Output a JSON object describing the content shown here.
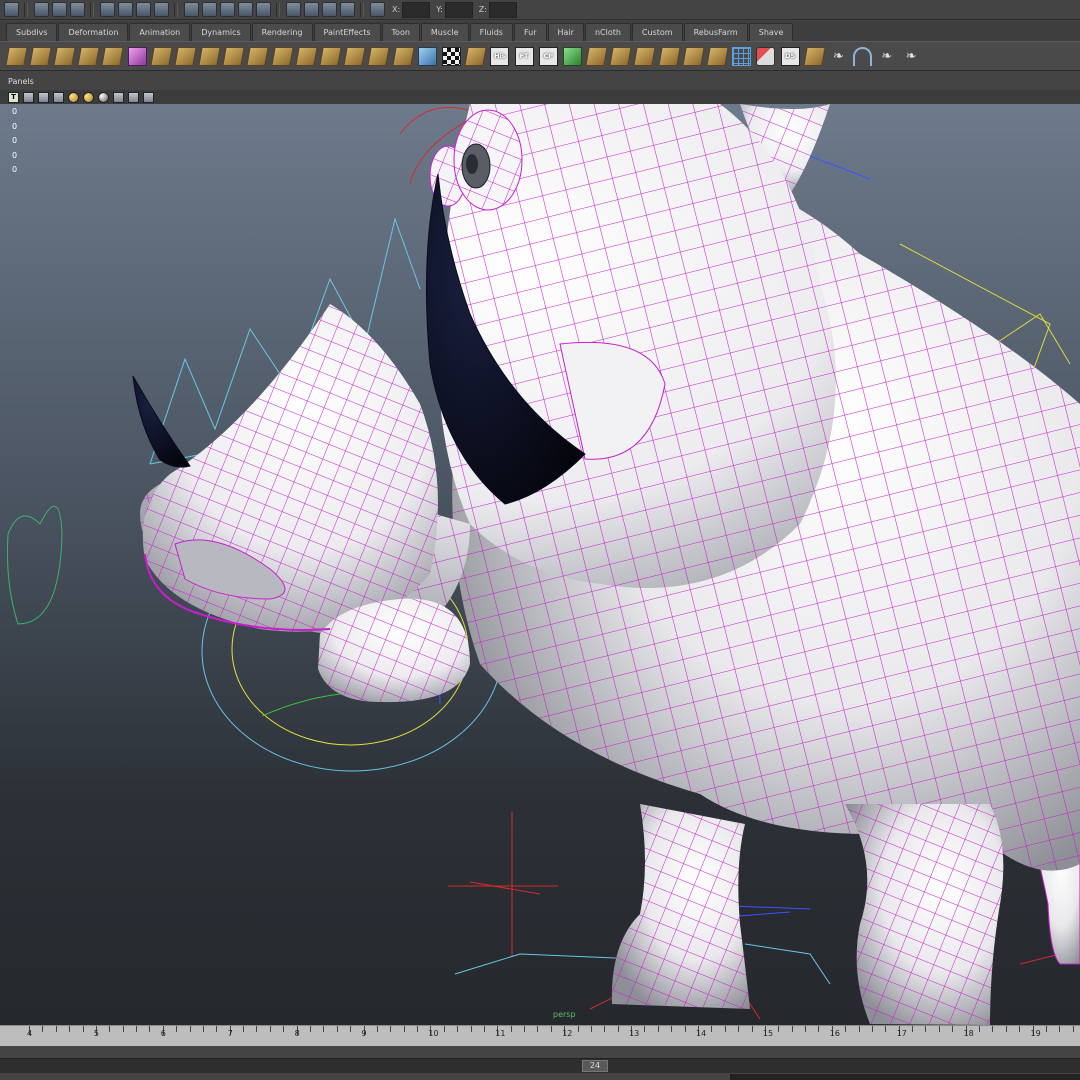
{
  "status_line": {
    "icons": [
      "menu-set-icon",
      "new-scene-icon",
      "open-scene-icon",
      "save-scene-icon",
      "select-hierarchy-icon",
      "select-object-icon",
      "select-component-icon",
      "lock-icon",
      "snap-grid-icon",
      "snap-curve-icon",
      "snap-point-icon",
      "snap-view-plane-icon",
      "make-live-icon",
      "render-frame-icon",
      "ipr-render-icon",
      "render-settings-icon",
      "hypershade-icon",
      "input-line-icon"
    ],
    "xyz_labels": [
      "X:",
      "Y:",
      "Z:"
    ]
  },
  "shelf_tabs": [
    "Subdivs",
    "Deformation",
    "Animation",
    "Dynamics",
    "Rendering",
    "PaintEffects",
    "Toon",
    "Muscle",
    "Fluids",
    "Fur",
    "Hair",
    "nCloth",
    "Custom",
    "RebusFarm",
    "Shave"
  ],
  "shelf_buttons": [
    {
      "icon": "paint-fur-icon",
      "label": ""
    },
    {
      "icon": "fur-description-icon",
      "label": ""
    },
    {
      "icon": "fur-offset-icon",
      "label": ""
    },
    {
      "icon": "fur-tile-1-icon",
      "label": ""
    },
    {
      "icon": "fur-tile-2-icon",
      "label": ""
    },
    {
      "icon": "shave-cube-icon",
      "label": ""
    },
    {
      "icon": "fur-tile-3-icon",
      "label": ""
    },
    {
      "icon": "fur-tile-4-icon",
      "label": ""
    },
    {
      "icon": "fur-tile-5-icon",
      "label": ""
    },
    {
      "icon": "fur-tile-6-icon",
      "label": ""
    },
    {
      "icon": "fur-tile-7-icon",
      "label": ""
    },
    {
      "icon": "fur-tile-8-icon",
      "label": ""
    },
    {
      "icon": "fur-tile-9-icon",
      "label": ""
    },
    {
      "icon": "fur-tile-10-icon",
      "label": ""
    },
    {
      "icon": "fur-tile-11-icon",
      "label": ""
    },
    {
      "icon": "fur-tile-12-icon",
      "label": ""
    },
    {
      "icon": "fur-tile-13-icon",
      "label": ""
    },
    {
      "icon": "hair-volume-icon",
      "label": ""
    },
    {
      "icon": "checker-pattern-icon",
      "label": ""
    },
    {
      "icon": "hair-select-icon",
      "label": ""
    },
    {
      "icon": "hair-history-icon",
      "label": "His"
    },
    {
      "icon": "hair-ft-icon",
      "label": "FT"
    },
    {
      "icon": "hair-cp-icon",
      "label": "CP"
    },
    {
      "icon": "play-simulation-icon",
      "label": ""
    },
    {
      "icon": "fur-tile-14-icon",
      "label": ""
    },
    {
      "icon": "fur-tile-15-icon",
      "label": ""
    },
    {
      "icon": "fur-tile-16-icon",
      "label": ""
    },
    {
      "icon": "fur-tile-17-icon",
      "label": ""
    },
    {
      "icon": "fur-tile-18-icon",
      "label": ""
    },
    {
      "icon": "fur-tile-19-icon",
      "label": ""
    },
    {
      "icon": "lattice-icon",
      "label": ""
    },
    {
      "icon": "paint-brush-icon",
      "label": ""
    },
    {
      "icon": "hair-ds-icon",
      "label": "DS"
    },
    {
      "icon": "fur-tile-20-icon",
      "label": ""
    },
    {
      "icon": "feather-1-icon",
      "label": ""
    },
    {
      "icon": "curve-tool-icon",
      "label": ""
    },
    {
      "icon": "feather-2-icon",
      "label": ""
    },
    {
      "icon": "feather-3-icon",
      "label": ""
    }
  ],
  "panel_menu": {
    "panels_label": "Panels"
  },
  "panel_toolbar": [
    "text-icon",
    "wireframe-icon",
    "smooth-shade-icon",
    "textured-icon",
    "default-light-icon",
    "all-lights-icon",
    "shadows-icon",
    "isolate-select-icon",
    "xray-icon",
    "joints-xray-icon"
  ],
  "viewport": {
    "hud_values": [
      "0",
      "0",
      "0",
      "0",
      "0"
    ],
    "camera_label": "persp",
    "colors": {
      "wire": "#c81ecf",
      "tusk": "#0a0c1c",
      "background_top": "#6d7a8b",
      "background_bottom": "#25282c"
    }
  },
  "time_slider": {
    "ticks": [
      "4",
      "5",
      "6",
      "7",
      "8",
      "9",
      "10",
      "11",
      "12",
      "13",
      "14",
      "15",
      "16",
      "17",
      "18",
      "19"
    ]
  },
  "range_slider": {
    "end_value": "24"
  }
}
